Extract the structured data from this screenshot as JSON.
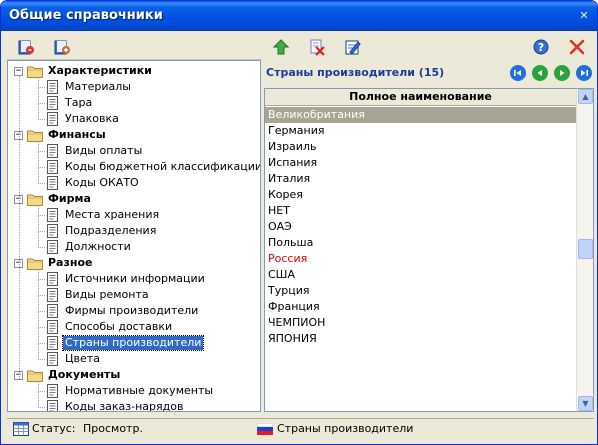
{
  "window": {
    "title": "Общие справочники"
  },
  "left_panel": {
    "tree": [
      {
        "type": "group",
        "label": "Характеристики"
      },
      {
        "type": "item",
        "label": "Материалы"
      },
      {
        "type": "item",
        "label": "Тара"
      },
      {
        "type": "item",
        "label": "Упаковка"
      },
      {
        "type": "group",
        "label": "Финансы"
      },
      {
        "type": "item",
        "label": "Виды оплаты"
      },
      {
        "type": "item",
        "label": "Коды бюджетной классификации"
      },
      {
        "type": "item",
        "label": "Коды ОКАТО"
      },
      {
        "type": "group",
        "label": "Фирма"
      },
      {
        "type": "item",
        "label": "Места хранения"
      },
      {
        "type": "item",
        "label": "Подразделения"
      },
      {
        "type": "item",
        "label": "Должности"
      },
      {
        "type": "group",
        "label": "Разное"
      },
      {
        "type": "item",
        "label": "Источники информации"
      },
      {
        "type": "item",
        "label": "Виды ремонта"
      },
      {
        "type": "item",
        "label": "Фирмы производители"
      },
      {
        "type": "item",
        "label": "Способы доставки"
      },
      {
        "type": "item",
        "label": "Страны производители",
        "selected": true
      },
      {
        "type": "item",
        "label": "Цвета"
      },
      {
        "type": "group",
        "label": "Документы"
      },
      {
        "type": "item",
        "label": "Нормативные документы"
      },
      {
        "type": "item",
        "label": "Коды заказ-нарядов"
      }
    ]
  },
  "right_panel": {
    "title": "Страны производители (15)",
    "column_header": "Полное наименование",
    "rows": [
      {
        "name": "Великобритания",
        "selected": true
      },
      {
        "name": "Германия"
      },
      {
        "name": "Израиль"
      },
      {
        "name": "Испания"
      },
      {
        "name": "Италия"
      },
      {
        "name": "Корея"
      },
      {
        "name": "НЕТ"
      },
      {
        "name": "ОАЭ"
      },
      {
        "name": "Польша"
      },
      {
        "name": "Россия",
        "highlight_color": "#e00000"
      },
      {
        "name": "США"
      },
      {
        "name": "Турция"
      },
      {
        "name": "Франция"
      },
      {
        "name": "ЧЕМПИОН"
      },
      {
        "name": "ЯПОНИЯ"
      }
    ]
  },
  "statusbar": {
    "label": "Статус:",
    "value": "Просмотр.",
    "reference": "Страны производители"
  },
  "icons": {
    "left_toolbar": [
      "open-book-icon",
      "add-book-icon"
    ],
    "right_toolbar": [
      "up-arrow-icon",
      "delete-icon",
      "edit-icon",
      "help-icon",
      "close-icon"
    ],
    "navigation": [
      "first-record-icon",
      "previous-record-icon",
      "next-record-icon",
      "last-record-icon"
    ]
  },
  "colors": {
    "title_bar": "#0050e0",
    "header_title": "#1a3aa0",
    "selection": "#316ac5",
    "grid_selection": "#a9a594",
    "highlight_red": "#e00000",
    "nav_button": "#1f6fdc",
    "close_x": "#e03020"
  }
}
